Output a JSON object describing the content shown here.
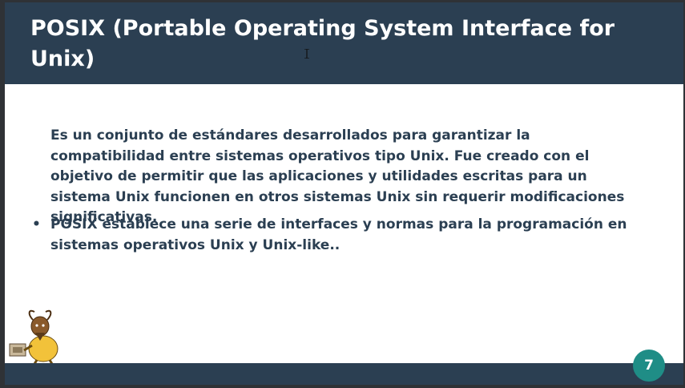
{
  "slide": {
    "title": "POSIX (Portable Operating System Interface for Unix)",
    "paragraph_1": "Es un conjunto de estándares desarrollados para garantizar la compatibilidad entre sistemas operativos tipo Unix. Fue creado con el objetivo de permitir que las aplicaciones y utilidades escritas para un sistema Unix funcionen en otros sistemas Unix sin requerir modificaciones significativas.",
    "bullet_symbol": "•",
    "paragraph_2": "POSIX establece una serie de interfaces y normas para la programación en sistemas operativos Unix y Unix-like..",
    "page_number": "7"
  },
  "colors": {
    "header": "#2b3f52",
    "body_text": "#2b3f52",
    "badge": "#1f8d86",
    "background": "#ffffff"
  },
  "icons": {
    "cursor": "text-cursor-icon",
    "mascot": "gnu-mascot-icon"
  }
}
